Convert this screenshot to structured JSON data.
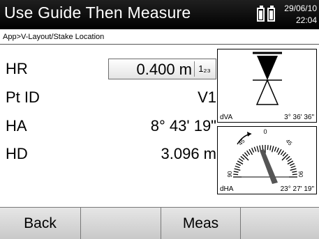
{
  "header": {
    "title": "Use Guide Then Measure",
    "date": "29/06/10",
    "time": "22:04",
    "battery_icon": "battery-icon"
  },
  "breadcrumb": "App>V-Layout/Stake Location",
  "fields": {
    "hr": {
      "label": "HR",
      "value": "0.400 m",
      "keypad_label": "1₂₃"
    },
    "pt_id": {
      "label": "Pt ID",
      "value": "V1"
    },
    "ha": {
      "label": "HA",
      "value": "8° 43' 19\""
    },
    "hd": {
      "label": "HD",
      "value": "3.096 m"
    }
  },
  "vertical_guide": {
    "label": "dVA",
    "value": "3° 36' 36\""
  },
  "horizontal_guide": {
    "label": "dHA",
    "value": "23° 27' 19\"",
    "scale_ticks": [
      "0",
      "45",
      "45",
      "90",
      "90"
    ],
    "needle_fraction": 0.26
  },
  "softkeys": [
    "Back",
    "",
    "Meas",
    ""
  ]
}
